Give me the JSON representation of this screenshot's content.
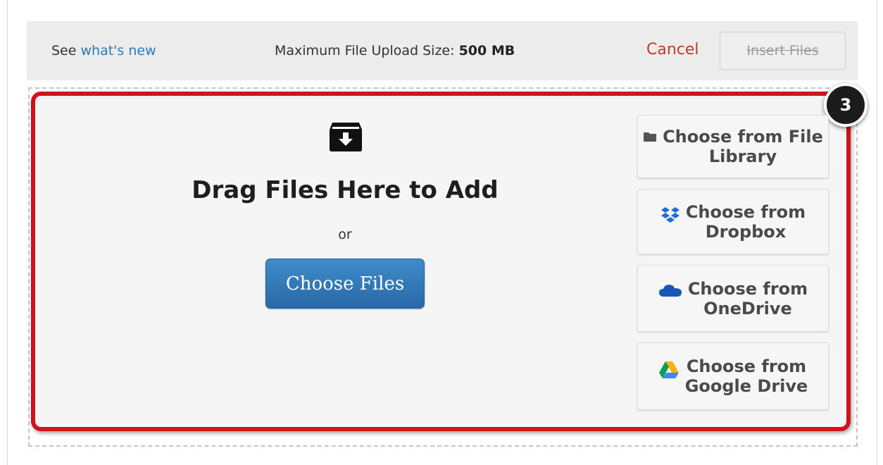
{
  "toolbar": {
    "see_prefix": "See",
    "whats_new_link": "what's new",
    "max_size_label": "Maximum File Upload Size:",
    "max_size_value": "500 MB",
    "cancel_label": "Cancel",
    "insert_label": "Insert Files"
  },
  "badge": {
    "number": "3"
  },
  "drop_zone": {
    "title": "Drag Files Here to Add",
    "or": "or",
    "choose_label": "Choose Files"
  },
  "sources": [
    {
      "label_line1": "Choose from File",
      "label_line2": "Library",
      "icon": "folder-icon"
    },
    {
      "label_line1": "Choose from",
      "label_line2": "Dropbox",
      "icon": "dropbox-icon"
    },
    {
      "label_line1": "Choose from",
      "label_line2": "OneDrive",
      "icon": "onedrive-icon"
    },
    {
      "label_line1": "Choose from",
      "label_line2": "Google Drive",
      "icon": "google-drive-icon"
    }
  ],
  "colors": {
    "accent_red": "#d0131b",
    "link_blue": "#2a7ab8",
    "primary_button": "#2f76b4",
    "cancel_red": "#c0392b"
  }
}
